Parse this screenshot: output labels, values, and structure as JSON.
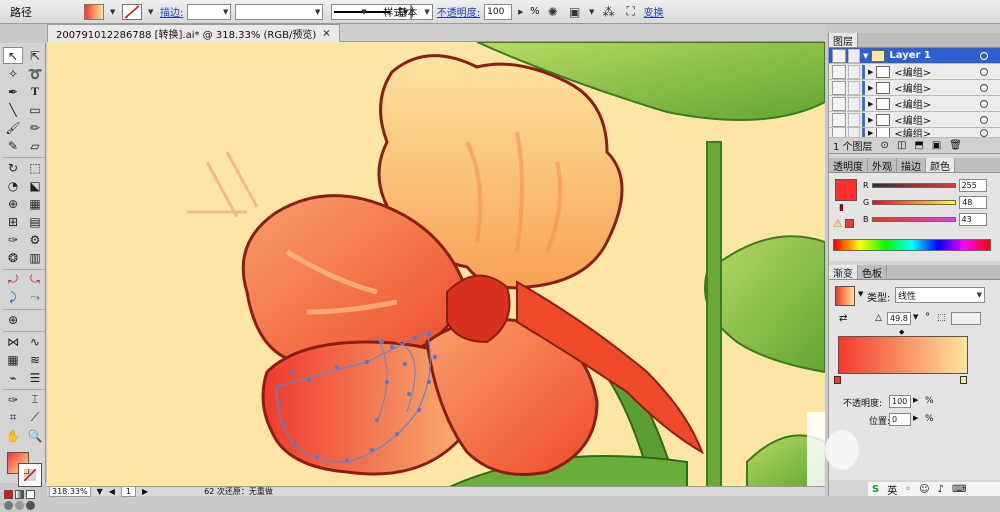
{
  "control_bar": {
    "object_label": "路径",
    "stroke_link": "描边:",
    "stroke_weight": "",
    "brush_label": "基本",
    "style_label": "样式:",
    "opacity_link": "不透明度:",
    "opacity_value": "100",
    "opacity_unit": "%",
    "transform_link": "变换"
  },
  "document": {
    "tab_title": "200791012286788 [转换].ai* @ 318.33% (RGB/预览)",
    "close_symbol": "×"
  },
  "status_bar": {
    "zoom": "318.33%",
    "page": "1",
    "info": "62 次还原：无重做"
  },
  "layers_panel": {
    "tab": "图层",
    "layer_name": "Layer 1",
    "groups": [
      "<编组>",
      "<编组>",
      "<编组>",
      "<编组>",
      "<编组>"
    ],
    "footer_count": "1 个图层"
  },
  "color_panel": {
    "tabs": [
      "透明度",
      "外观",
      "描边",
      "颜色"
    ],
    "active_tab": "颜色",
    "r_label": "R",
    "r_value": "255",
    "g_label": "G",
    "g_value": "48",
    "b_label": "B",
    "b_value": "43",
    "current_color": "#ff302b"
  },
  "gradient_panel": {
    "tabs": [
      "渐变",
      "色板"
    ],
    "active_tab": "渐变",
    "type_label": "类型:",
    "type_value": "线性",
    "angle_value": "49.8",
    "angle_unit": "°",
    "opacity_label": "不透明度:",
    "opacity_value": "100",
    "opacity_unit": "%",
    "location_label": "位置:",
    "location_value": "0",
    "location_unit": "%",
    "start_color": "#f53a2c",
    "end_color": "#fde59a"
  },
  "ime": {
    "lang": "英"
  }
}
